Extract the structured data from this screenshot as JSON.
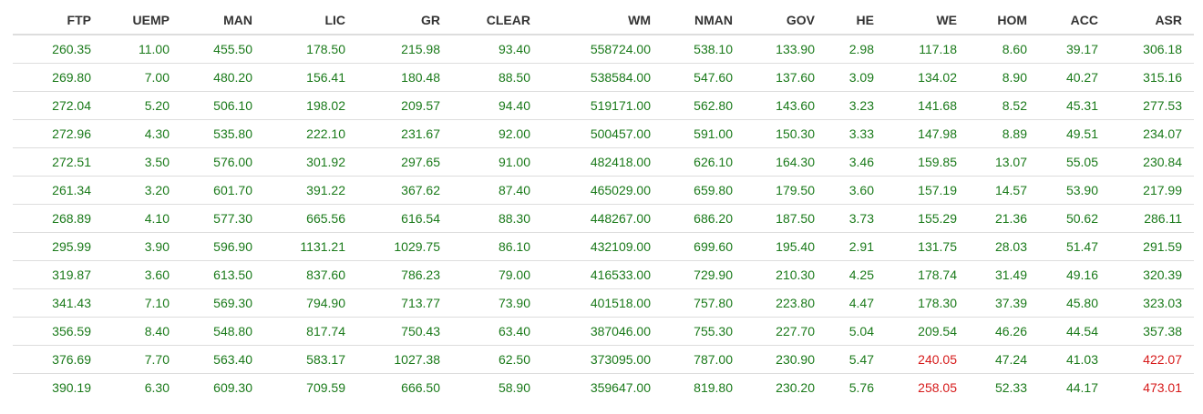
{
  "colors": {
    "normal": "#1a7a1a",
    "highlight": "#d61a1a"
  },
  "columns": [
    "FTP",
    "UEMP",
    "MAN",
    "LIC",
    "GR",
    "CLEAR",
    "WM",
    "NMAN",
    "GOV",
    "HE",
    "WE",
    "HOM",
    "ACC",
    "ASR"
  ],
  "rows": [
    [
      "260.35",
      "11.00",
      "455.50",
      "178.50",
      "215.98",
      "93.40",
      "558724.00",
      "538.10",
      "133.90",
      "2.98",
      "117.18",
      "8.60",
      "39.17",
      "306.18"
    ],
    [
      "269.80",
      "7.00",
      "480.20",
      "156.41",
      "180.48",
      "88.50",
      "538584.00",
      "547.60",
      "137.60",
      "3.09",
      "134.02",
      "8.90",
      "40.27",
      "315.16"
    ],
    [
      "272.04",
      "5.20",
      "506.10",
      "198.02",
      "209.57",
      "94.40",
      "519171.00",
      "562.80",
      "143.60",
      "3.23",
      "141.68",
      "8.52",
      "45.31",
      "277.53"
    ],
    [
      "272.96",
      "4.30",
      "535.80",
      "222.10",
      "231.67",
      "92.00",
      "500457.00",
      "591.00",
      "150.30",
      "3.33",
      "147.98",
      "8.89",
      "49.51",
      "234.07"
    ],
    [
      "272.51",
      "3.50",
      "576.00",
      "301.92",
      "297.65",
      "91.00",
      "482418.00",
      "626.10",
      "164.30",
      "3.46",
      "159.85",
      "13.07",
      "55.05",
      "230.84"
    ],
    [
      "261.34",
      "3.20",
      "601.70",
      "391.22",
      "367.62",
      "87.40",
      "465029.00",
      "659.80",
      "179.50",
      "3.60",
      "157.19",
      "14.57",
      "53.90",
      "217.99"
    ],
    [
      "268.89",
      "4.10",
      "577.30",
      "665.56",
      "616.54",
      "88.30",
      "448267.00",
      "686.20",
      "187.50",
      "3.73",
      "155.29",
      "21.36",
      "50.62",
      "286.11"
    ],
    [
      "295.99",
      "3.90",
      "596.90",
      "1131.21",
      "1029.75",
      "86.10",
      "432109.00",
      "699.60",
      "195.40",
      "2.91",
      "131.75",
      "28.03",
      "51.47",
      "291.59"
    ],
    [
      "319.87",
      "3.60",
      "613.50",
      "837.60",
      "786.23",
      "79.00",
      "416533.00",
      "729.90",
      "210.30",
      "4.25",
      "178.74",
      "31.49",
      "49.16",
      "320.39"
    ],
    [
      "341.43",
      "7.10",
      "569.30",
      "794.90",
      "713.77",
      "73.90",
      "401518.00",
      "757.80",
      "223.80",
      "4.47",
      "178.30",
      "37.39",
      "45.80",
      "323.03"
    ],
    [
      "356.59",
      "8.40",
      "548.80",
      "817.74",
      "750.43",
      "63.40",
      "387046.00",
      "755.30",
      "227.70",
      "5.04",
      "209.54",
      "46.26",
      "44.54",
      "357.38"
    ],
    [
      "376.69",
      "7.70",
      "563.40",
      "583.17",
      "1027.38",
      "62.50",
      "373095.00",
      "787.00",
      "230.90",
      "5.47",
      "240.05",
      "47.24",
      "41.03",
      "422.07"
    ],
    [
      "390.19",
      "6.30",
      "609.30",
      "709.59",
      "666.50",
      "58.90",
      "359647.00",
      "819.80",
      "230.20",
      "5.76",
      "258.05",
      "52.33",
      "44.17",
      "473.01"
    ]
  ],
  "highlighted_cells": [
    [
      11,
      10
    ],
    [
      11,
      13
    ],
    [
      12,
      10
    ],
    [
      12,
      13
    ]
  ]
}
